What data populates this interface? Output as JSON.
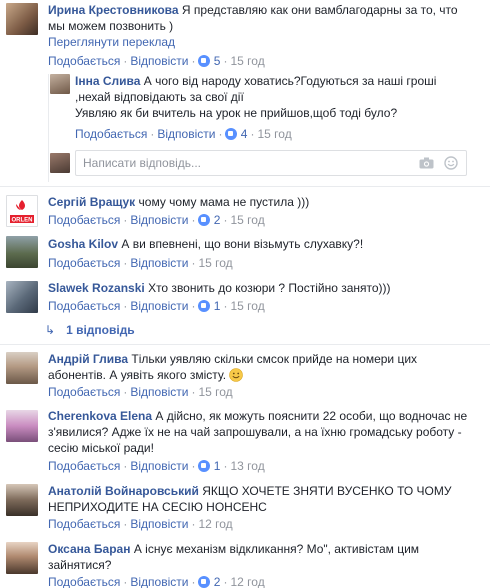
{
  "labels": {
    "like": "Подобається",
    "reply": "Відповісти",
    "sep": "·",
    "translate": "Переглянути переклад",
    "reply_placeholder": "Написати відповідь..."
  },
  "comments": [
    {
      "name": "Ирина Крестовникова",
      "text1": "Я представляю как они вамблагодарны за то, что",
      "text2": "мы можем позвонить )",
      "likes": "5",
      "time": "15 год"
    },
    {
      "name": "Інна Слива",
      "text1": "А чого від народу ховатись?Годуються за наші гроші",
      "text2": ",нехай відповідають за свої дії",
      "text3": "Уявляю як би вчитель на урок не прийшов,щоб тоді було?",
      "likes": "4",
      "time": "15 год"
    },
    {
      "name": "Сергій Вращук",
      "text1": "чому чому мама не пустила )))",
      "likes": "2",
      "time": "15 год"
    },
    {
      "name": "Gosha Kilov",
      "text1": "А ви впевнені, що вони візьмуть слухавку?!",
      "time": "15 год"
    },
    {
      "name": "Slawek Rozanski",
      "text1": "Хто звонить до козюри ? Постійно занято)))",
      "likes": "1",
      "time": "15 год",
      "replies": "1 відповідь"
    },
    {
      "name": "Андрій Глива",
      "text1": "Тільки уявляю скільки смсок прийде на номери цих",
      "text2": "абонентів. А уявіть якого змісту.",
      "time": "15 год"
    },
    {
      "name": "Cherenkova Elena",
      "text1": "А дійсно, як можуть пояснити 22 особи, що водночас не",
      "text2": "з'явилися? Адже їх не на чай запрошували, а на їхню громадську роботу -",
      "text3": "сесію міської ради!",
      "likes": "1",
      "time": "13 год"
    },
    {
      "name": "Анатолій Войнаровський",
      "text1": "ЯКЩО ХОЧЕТЕ ЗНЯТИ ВУСЕНКО ТО ЧОМУ",
      "text2": "НЕПРИХОДИТЕ НА СЕСІЮ НОНСЕНС",
      "time": "12 год"
    },
    {
      "name": "Оксана Баран",
      "text1": "А існує механізм відкликання? Мо\", активістам цим",
      "text2": "зайнятися?",
      "likes": "2",
      "time": "12 год"
    }
  ],
  "orlen_logo": "ORLEN",
  "colors": {
    "link": "#4267b2",
    "name": "#365899",
    "meta": "#90949c",
    "like_blue": "#5890ff"
  }
}
